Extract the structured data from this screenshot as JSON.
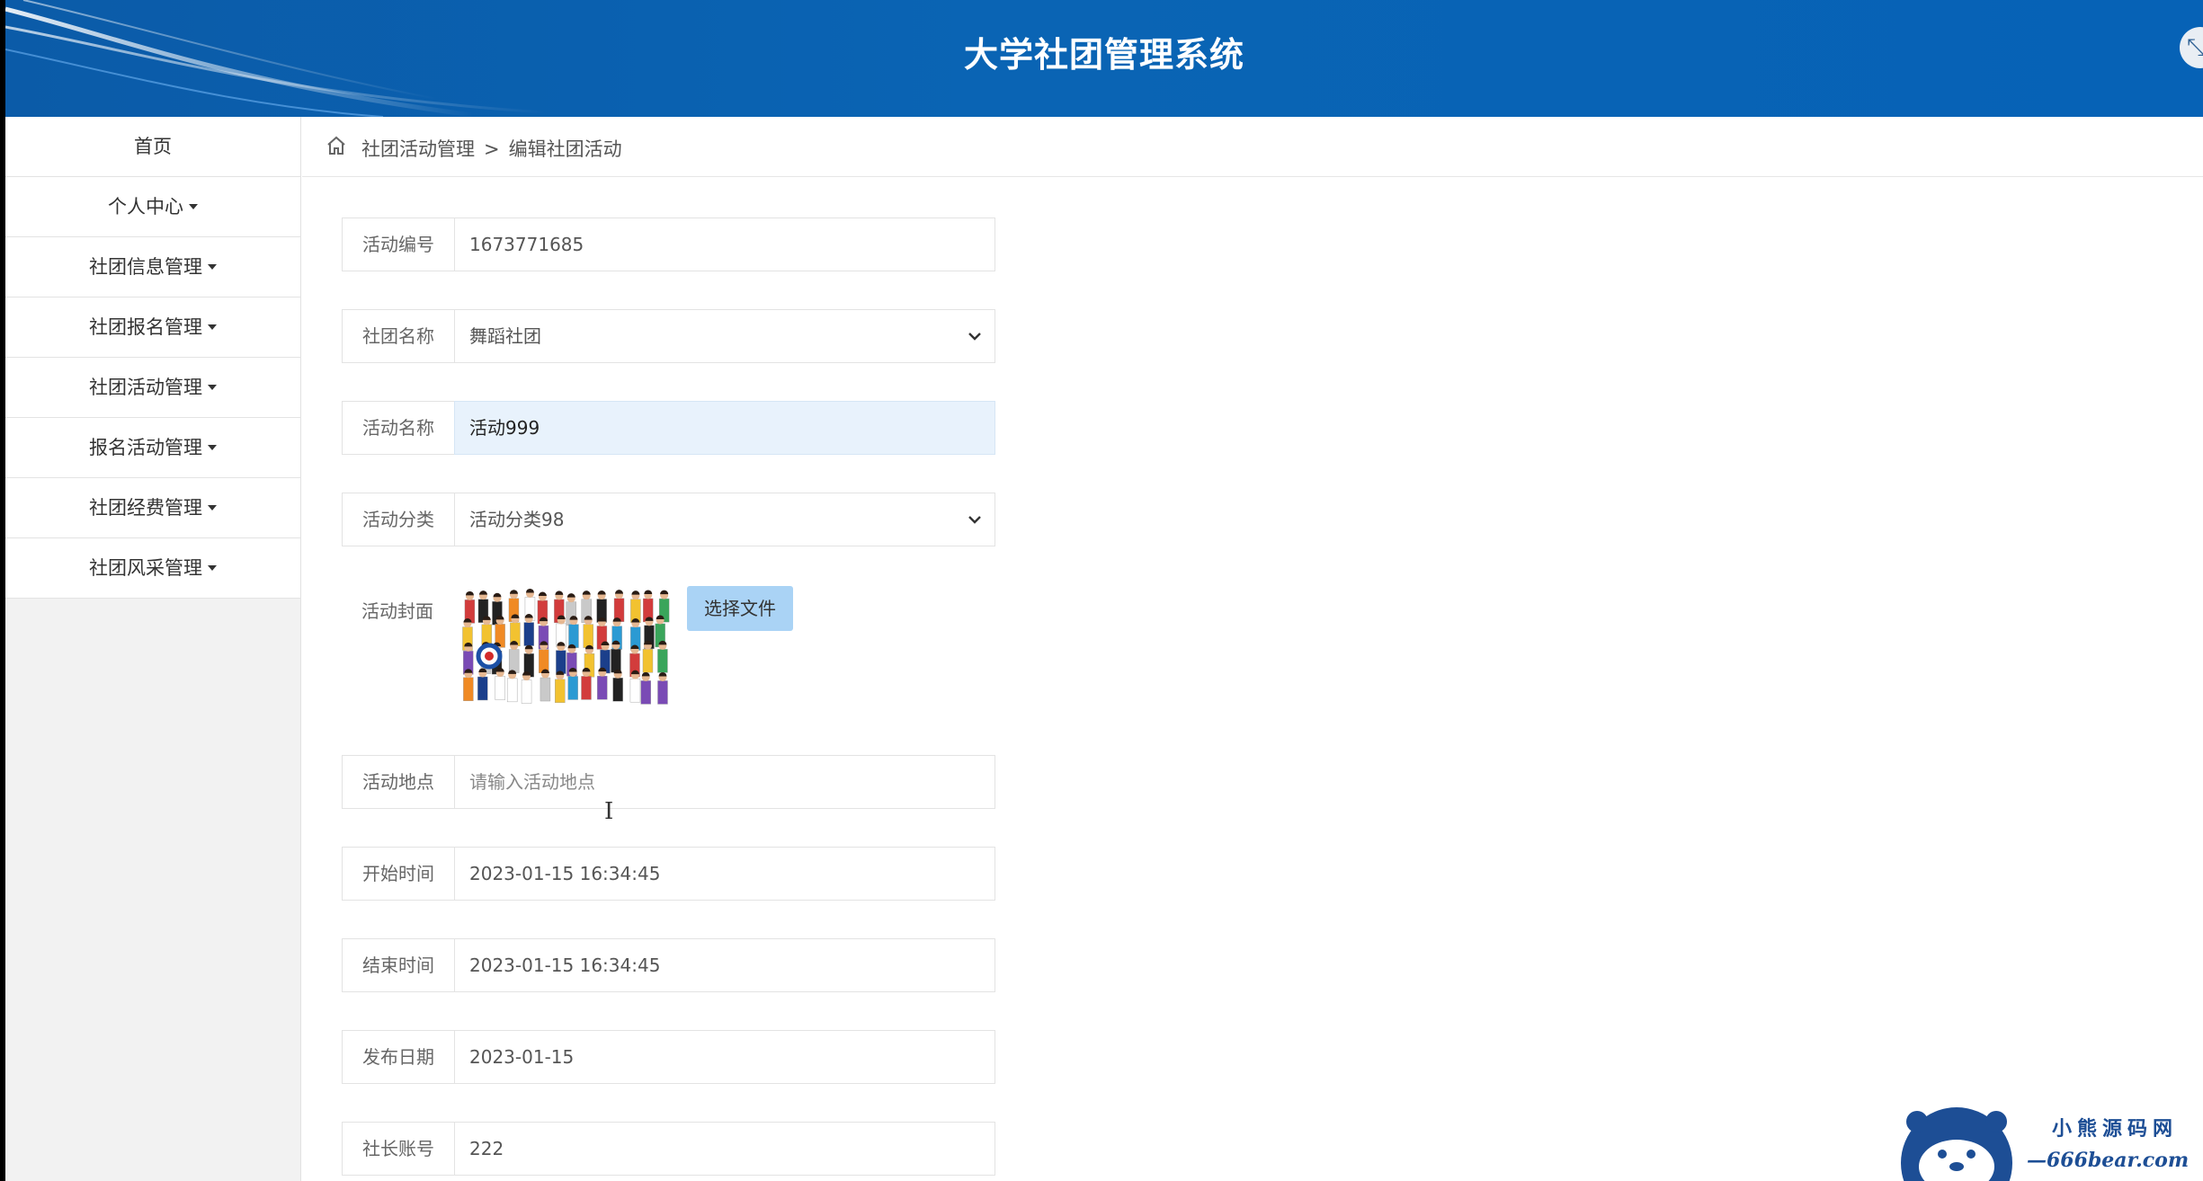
{
  "header": {
    "title": "大学社团管理系统"
  },
  "sidebar": {
    "items": [
      {
        "label": "首页",
        "dropdown": false
      },
      {
        "label": "个人中心",
        "dropdown": true
      },
      {
        "label": "社团信息管理",
        "dropdown": true
      },
      {
        "label": "社团报名管理",
        "dropdown": true
      },
      {
        "label": "社团活动管理",
        "dropdown": true
      },
      {
        "label": "报名活动管理",
        "dropdown": true
      },
      {
        "label": "社团经费管理",
        "dropdown": true
      },
      {
        "label": "社团风采管理",
        "dropdown": true
      }
    ]
  },
  "breadcrumb": {
    "section": "社团活动管理",
    "separator": ">",
    "page": "编辑社团活动"
  },
  "form": {
    "activity_no": {
      "label": "活动编号",
      "value": "1673771685"
    },
    "club_name": {
      "label": "社团名称",
      "value": "舞蹈社团"
    },
    "activity_name": {
      "label": "活动名称",
      "value": "活动999"
    },
    "category": {
      "label": "活动分类",
      "value": "活动分类98"
    },
    "cover": {
      "label": "活动封面",
      "button": "选择文件"
    },
    "location": {
      "label": "活动地点",
      "placeholder": "请输入活动地点"
    },
    "start_time": {
      "label": "开始时间",
      "value": "2023-01-15 16:34:45"
    },
    "end_time": {
      "label": "结束时间",
      "value": "2023-01-15 16:34:45"
    },
    "publish_date": {
      "label": "发布日期",
      "value": "2023-01-15"
    },
    "leader_account": {
      "label": "社长账号",
      "value": "222"
    }
  },
  "watermark": {
    "cn": "小熊源码网",
    "en": "—666bear.com—"
  },
  "colors": {
    "header_blue": "#0a64b4",
    "focus_bg": "#e8f2fc",
    "file_button": "#aad3f5",
    "watermark": "#1d4e95"
  }
}
